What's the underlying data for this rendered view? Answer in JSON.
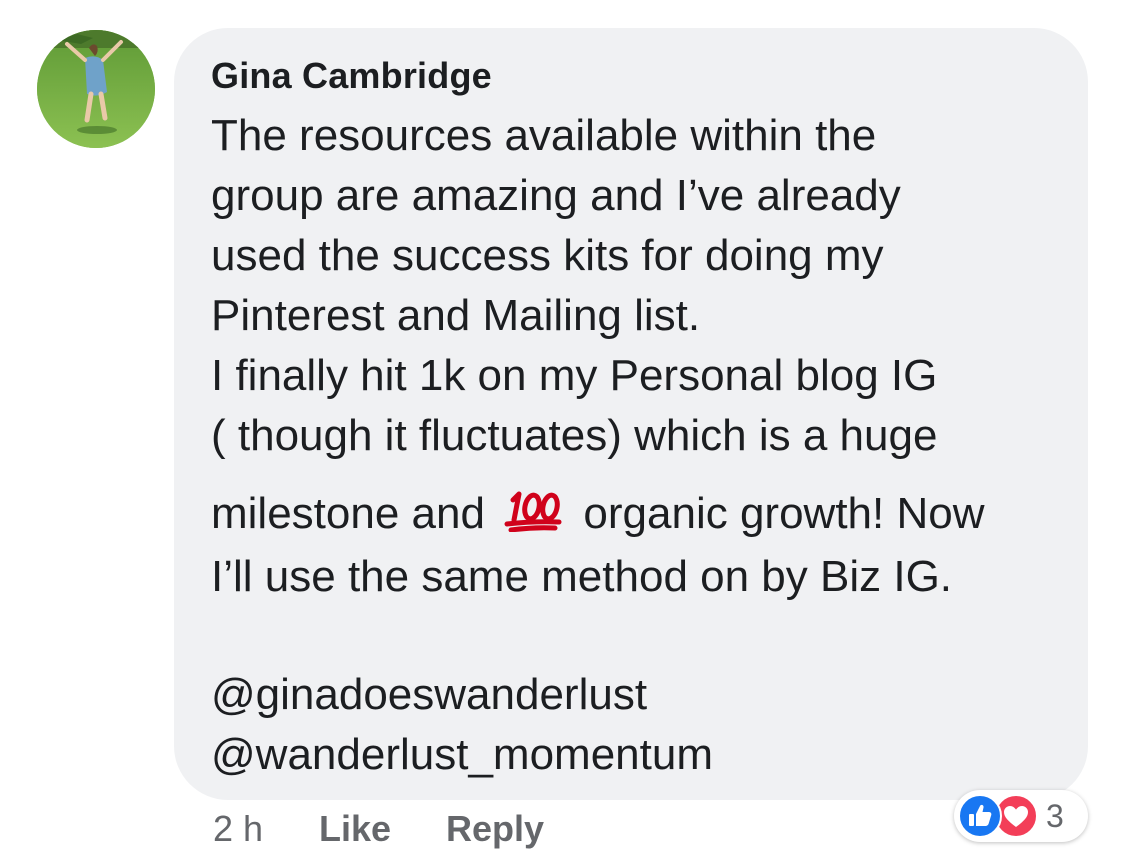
{
  "comment": {
    "author": "Gina Cambridge",
    "lines": [
      "The resources available within the",
      "group are amazing and I’ve already",
      "used the success kits for doing my",
      "Pinterest and Mailing list.",
      "I finally hit 1k on my Personal blog IG",
      "( though it fluctuates) which is a huge",
      "milestone and",
      "organic growth! Now",
      "I’ll use the same method on by Biz IG.",
      "@ginadoeswanderlust",
      "@wanderlust_momentum"
    ],
    "emoji": "hundred-points-emoji"
  },
  "actions": {
    "time": "2 h",
    "like_label": "Like",
    "reply_label": "Reply"
  },
  "reactions": {
    "icons": [
      "like-reaction-icon",
      "love-reaction-icon"
    ],
    "count": "3"
  },
  "colors": {
    "bubble": "#f0f1f3",
    "text": "#1c1e21",
    "meta": "#65676b",
    "like": "#1877f2",
    "love": "#f33e58"
  }
}
